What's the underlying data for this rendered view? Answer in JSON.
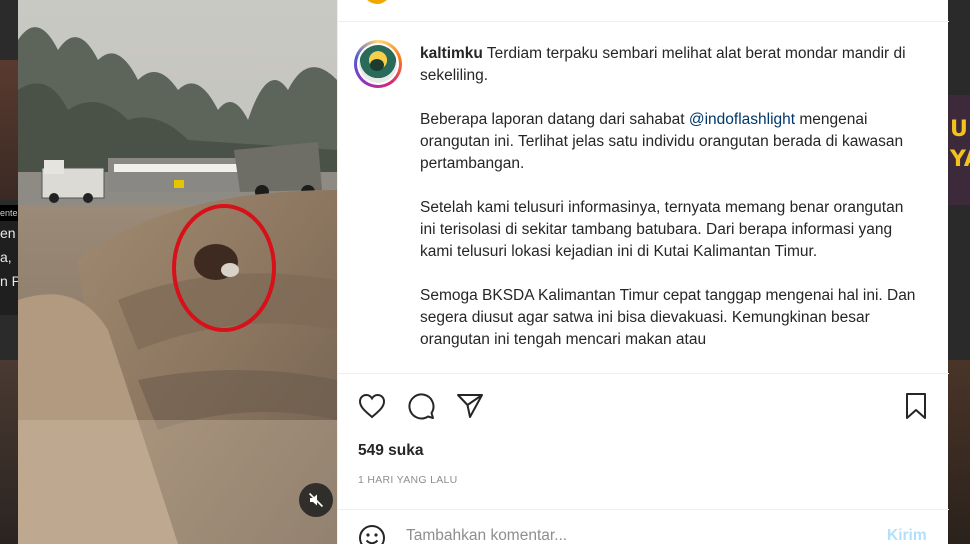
{
  "background": {
    "left_text": [
      "en",
      "a,",
      "n P"
    ],
    "left_label": "ente",
    "right_poster": [
      "U",
      "YA"
    ]
  },
  "post": {
    "username": "kaltimku",
    "caption": [
      "Terdiam terpaku sembari melihat alat berat mondar mandir di sekeliling.",
      {
        "before": "Beberapa laporan datang dari sahabat ",
        "mention": "@indoflashlight",
        "after": " mengenai orangutan ini. Terlihat jelas satu individu orangutan berada di kawasan pertambangan."
      },
      "Setelah kami telusuri informasinya, ternyata memang benar orangutan ini terisolasi di sekitar tambang batubara. Dari berapa informasi yang kami telusuri lokasi kejadian ini di Kutai Kalimantan Timur.",
      "Semoga BKSDA Kalimantan Timur cepat tanggap mengenai hal ini. Dan segera diusut agar satwa ini bisa dievakuasi. Kemungkinan besar orangutan ini tengah mencari makan atau"
    ],
    "likes": "549 suka",
    "time": "1 HARI YANG LALU",
    "comment_placeholder": "Tambahkan komentar...",
    "post_label": "Kirim"
  },
  "icons": {
    "like": "heart-icon",
    "comment": "comment-icon",
    "share": "send-icon",
    "save": "bookmark-icon",
    "mute": "speaker-muted-icon",
    "emoji": "emoji-icon"
  },
  "colors": {
    "link": "#00376b",
    "muted_text": "#8e8e8e",
    "post_button_disabled": "#b2dffc",
    "highlight_circle": "#d8101a"
  }
}
